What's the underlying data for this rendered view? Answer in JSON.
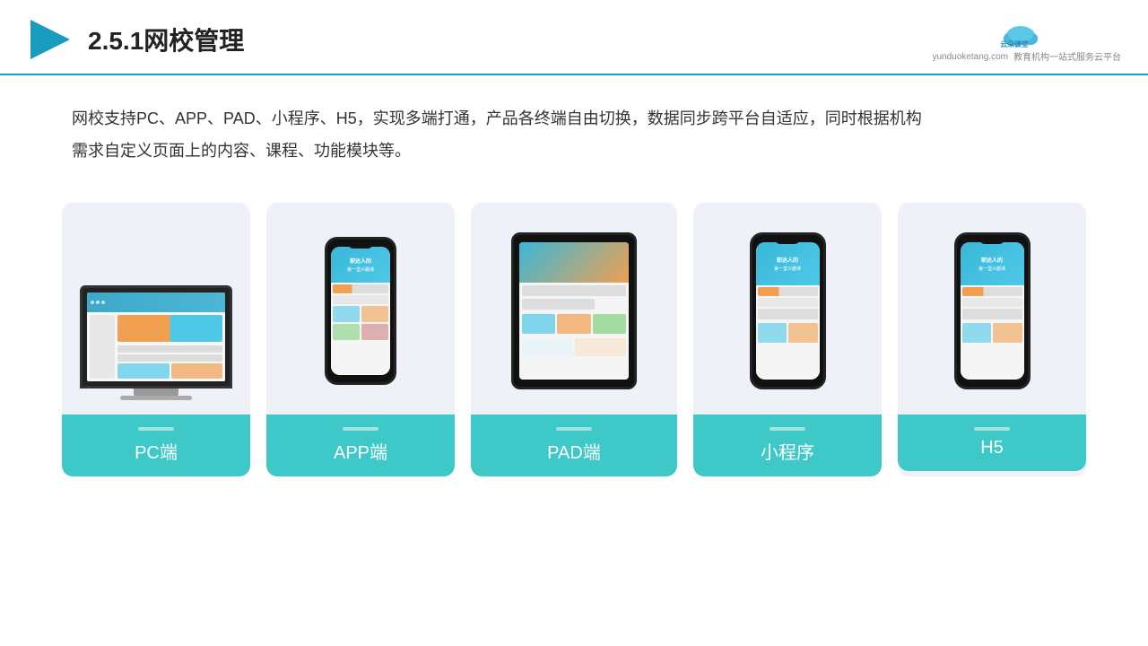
{
  "header": {
    "title": "2.5.1网校管理",
    "logo_url": "yunduoketang.com",
    "logo_tagline": "教育机构一站\n式服务云平台"
  },
  "description": {
    "text": "网校支持PC、APP、PAD、小程序、H5，实现多端打通，产品各终端自由切换，数据同步跨平台自适应，同时根据机构需求自定义页面上的内容、课程、功能模块等。"
  },
  "cards": [
    {
      "id": "pc",
      "label": "PC端"
    },
    {
      "id": "app",
      "label": "APP端"
    },
    {
      "id": "pad",
      "label": "PAD端"
    },
    {
      "id": "miniapp",
      "label": "小程序"
    },
    {
      "id": "h5",
      "label": "H5"
    }
  ],
  "colors": {
    "teal": "#3fc8c8",
    "header_border": "#1a9cbf",
    "card_bg": "#eef2f8"
  }
}
